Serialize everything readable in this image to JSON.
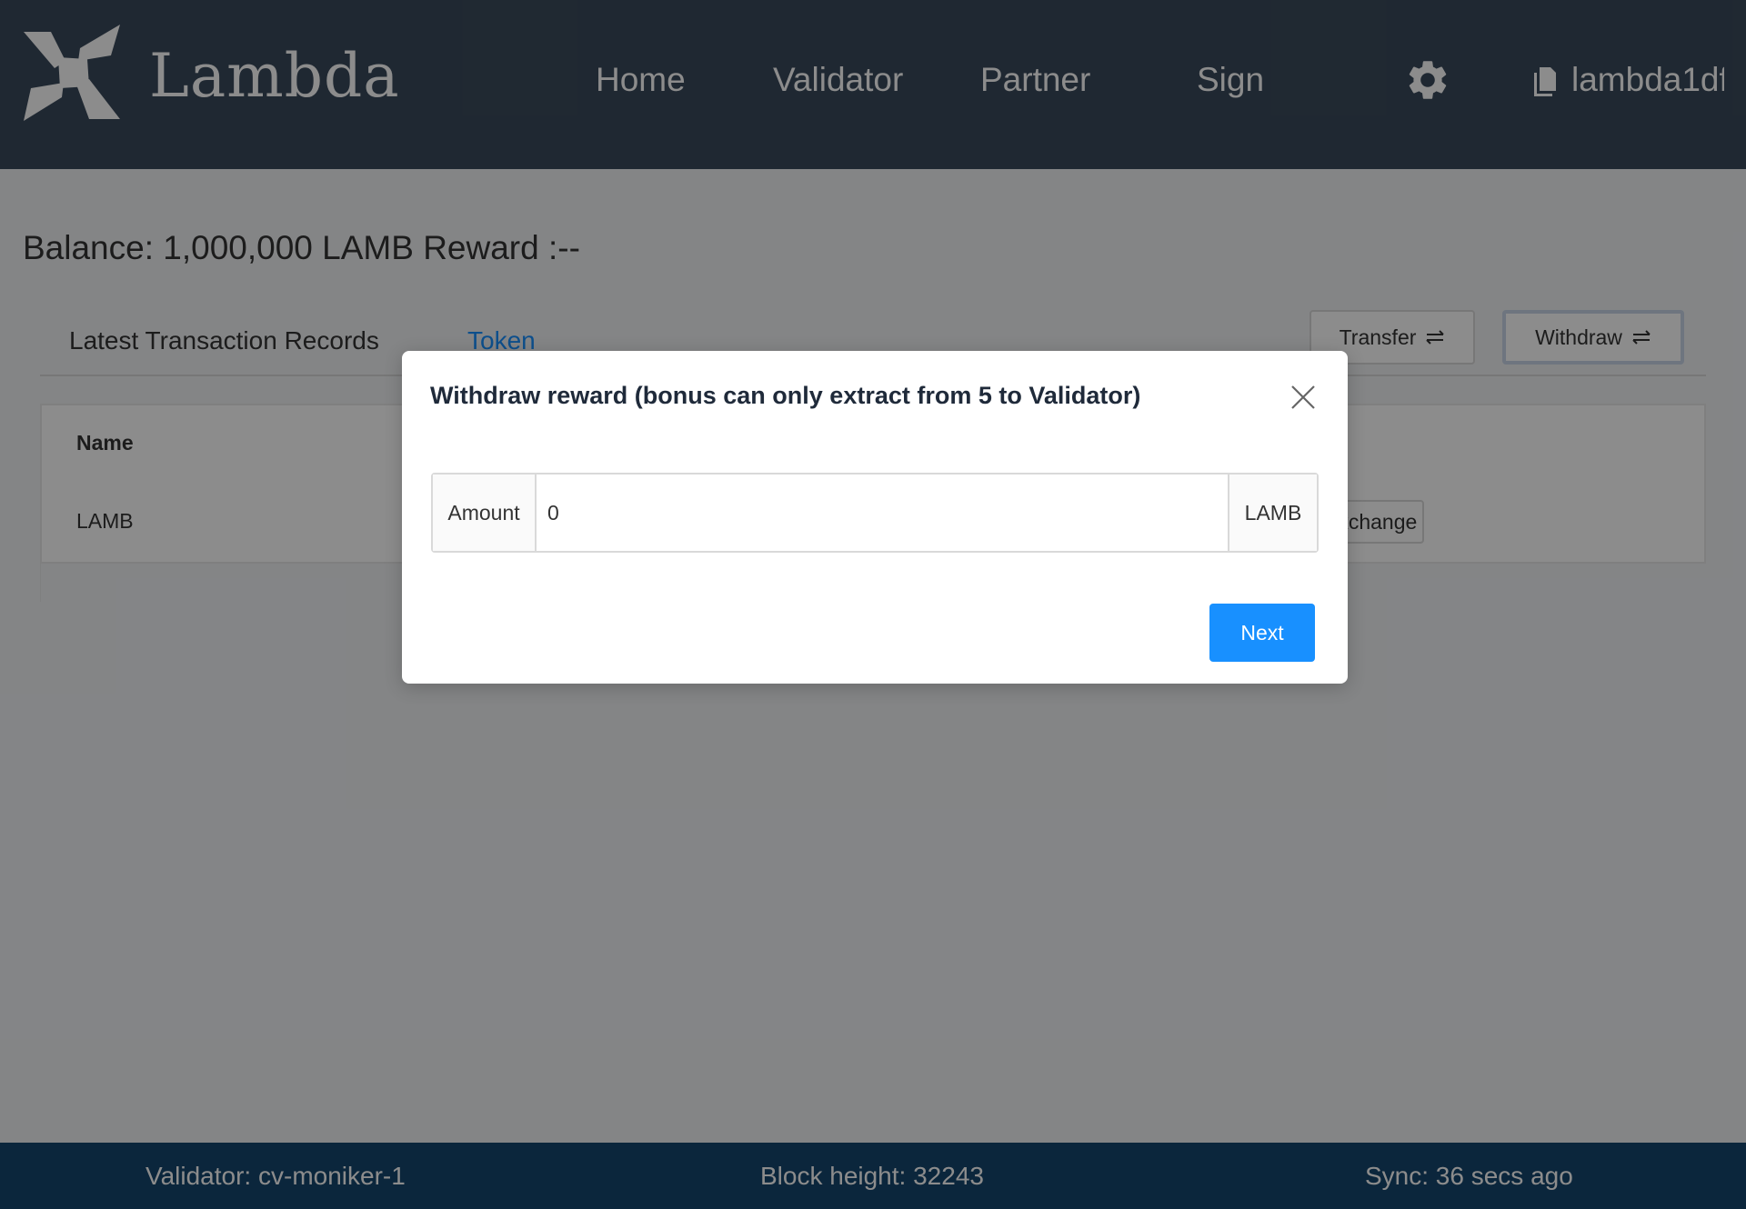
{
  "header": {
    "logo_text": "Lambda",
    "nav": {
      "home": "Home",
      "validator": "Validator",
      "partner": "Partner",
      "sign": "Sign"
    },
    "settings_icon": "gear-icon",
    "account_icon": "document-icon",
    "account_text": "lambda1df"
  },
  "main": {
    "balance_text": "Balance: 1,000,000 LAMB Reward :--",
    "tabs": [
      {
        "label": "Latest Transaction Records"
      },
      {
        "label": "Token"
      }
    ],
    "buttons": {
      "transfer": "Transfer",
      "withdraw": "Withdraw"
    },
    "table": {
      "header_name": "Name",
      "rows": [
        {
          "name": "LAMB",
          "action": "Exchange"
        }
      ]
    }
  },
  "modal": {
    "title": "Withdraw reward (bonus can only extract from 5 to Validator)",
    "amount_label": "Amount",
    "amount_value": "0",
    "unit": "LAMB",
    "next_label": "Next"
  },
  "footer": {
    "validator": "Validator: cv-moniker-1",
    "block_height": "Block height: 32243",
    "sync": "Sync: 36 secs ago"
  },
  "colors": {
    "header_bg": "#3a4a5b",
    "footer_bg": "#14466d",
    "primary": "#1890ff"
  }
}
